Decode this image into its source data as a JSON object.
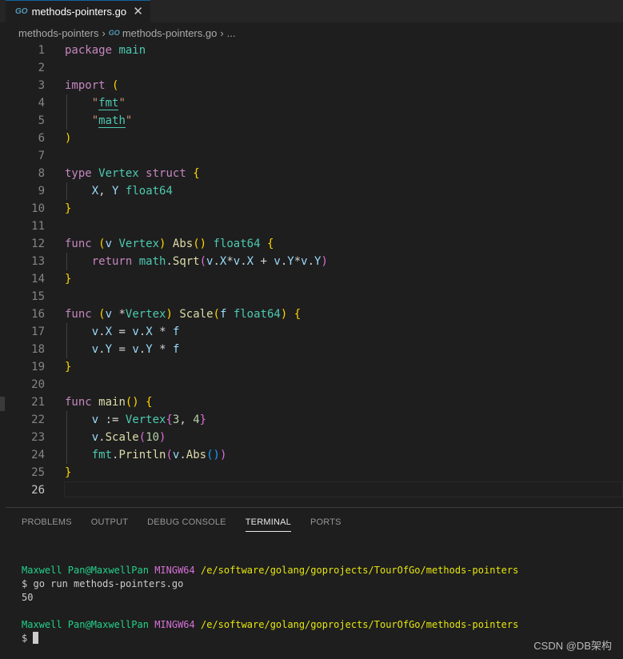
{
  "tab": {
    "label": "methods-pointers.go",
    "icon": "go-file-icon"
  },
  "breadcrumb": {
    "folder": "methods-pointers",
    "file": "methods-pointers.go",
    "more": "..."
  },
  "editor": {
    "lines": [
      {
        "n": "1"
      },
      {
        "n": "2"
      },
      {
        "n": "3"
      },
      {
        "n": "4"
      },
      {
        "n": "5"
      },
      {
        "n": "6"
      },
      {
        "n": "7"
      },
      {
        "n": "8"
      },
      {
        "n": "9"
      },
      {
        "n": "10"
      },
      {
        "n": "11"
      },
      {
        "n": "12"
      },
      {
        "n": "13"
      },
      {
        "n": "14"
      },
      {
        "n": "15"
      },
      {
        "n": "16"
      },
      {
        "n": "17"
      },
      {
        "n": "18"
      },
      {
        "n": "19"
      },
      {
        "n": "20"
      },
      {
        "n": "21"
      },
      {
        "n": "22"
      },
      {
        "n": "23"
      },
      {
        "n": "24"
      },
      {
        "n": "25"
      },
      {
        "n": "26"
      }
    ]
  },
  "panel": {
    "tabs": [
      "PROBLEMS",
      "OUTPUT",
      "DEBUG CONSOLE",
      "TERMINAL",
      "PORTS"
    ],
    "terminal": {
      "user": "Maxwell Pan@MaxwellPan",
      "env": "MINGW64",
      "path": "/e/software/golang/goprojects/TourOfGo/methods-pointers",
      "prompt": "$",
      "command": "go run methods-pointers.go",
      "output": "50"
    }
  },
  "watermark": "CSDN @DB架构"
}
